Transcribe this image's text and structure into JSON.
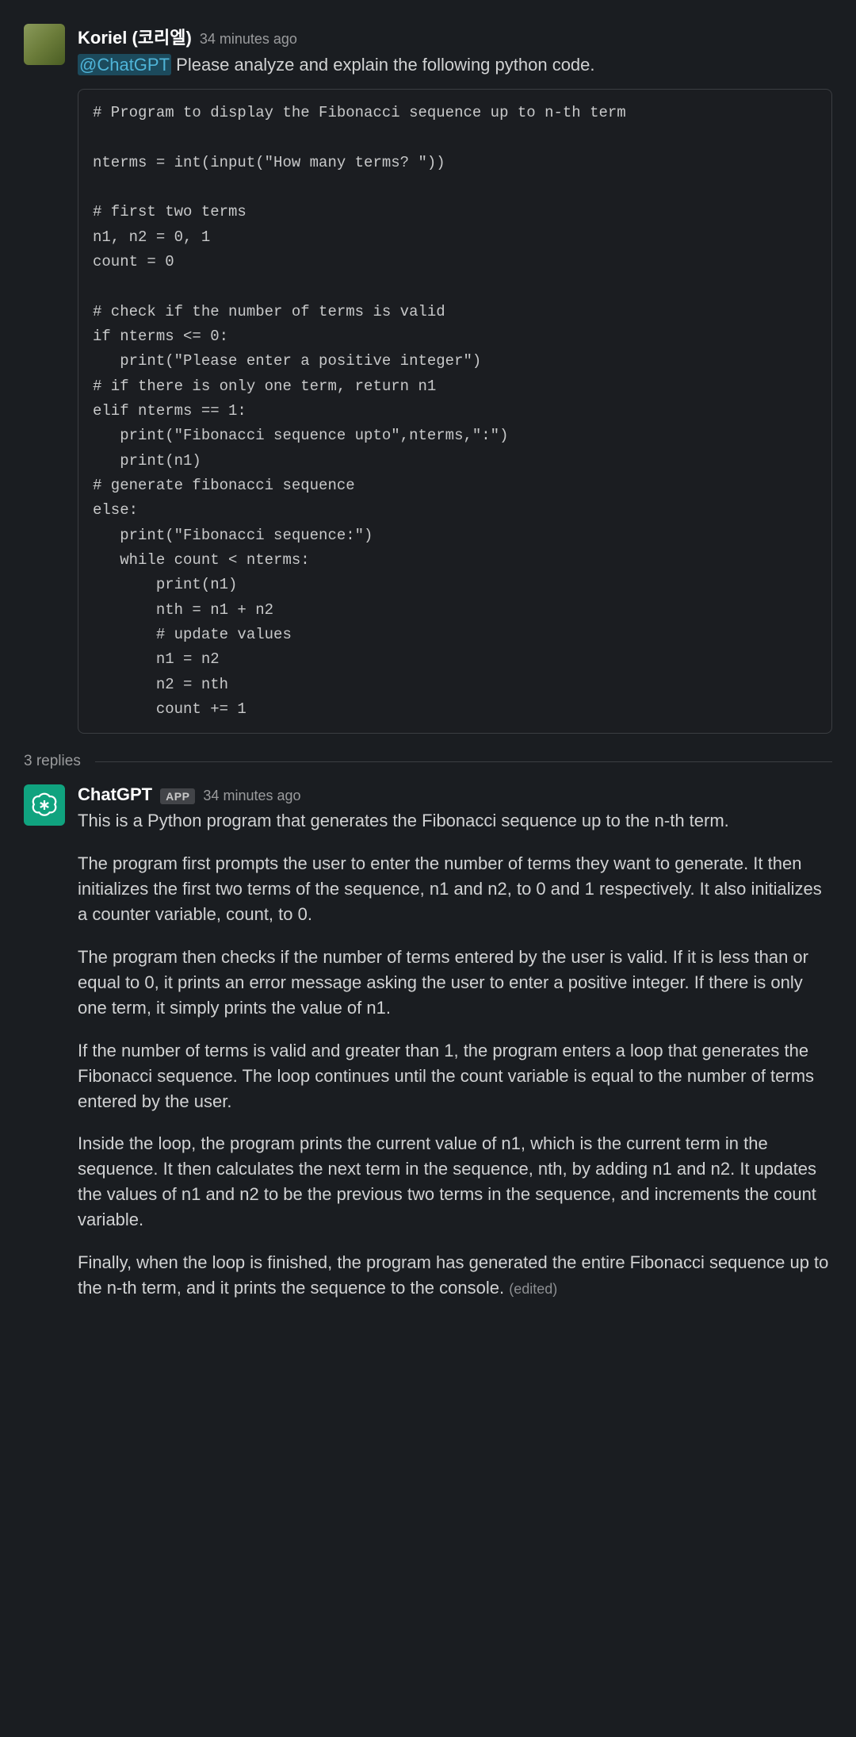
{
  "message1": {
    "username": "Koriel (코리엘)",
    "timestamp": "34 minutes ago",
    "mention": "@ChatGPT",
    "text": " Please analyze and explain the following python code.",
    "code": "# Program to display the Fibonacci sequence up to n-th term\n\nnterms = int(input(\"How many terms? \"))\n\n# first two terms\nn1, n2 = 0, 1\ncount = 0\n\n# check if the number of terms is valid\nif nterms <= 0:\n   print(\"Please enter a positive integer\")\n# if there is only one term, return n1\nelif nterms == 1:\n   print(\"Fibonacci sequence upto\",nterms,\":\")\n   print(n1)\n# generate fibonacci sequence\nelse:\n   print(\"Fibonacci sequence:\")\n   while count < nterms:\n       print(n1)\n       nth = n1 + n2\n       # update values\n       n1 = n2\n       n2 = nth\n       count += 1"
  },
  "replies_label": "3 replies",
  "message2": {
    "username": "ChatGPT",
    "app_badge": "APP",
    "timestamp": "34 minutes ago",
    "paragraphs": [
      "This is a Python program that generates the Fibonacci sequence up to the n-th term.",
      "The program first prompts the user to enter the number of terms they want to generate. It then initializes the first two terms of the sequence, n1 and n2, to 0 and 1 respectively. It also initializes a counter variable, count, to 0.",
      "The program then checks if the number of terms entered by the user is valid. If it is less than or equal to 0, it prints an error message asking the user to enter a positive integer. If there is only one term, it simply prints the value of n1.",
      "If the number of terms is valid and greater than 1, the program enters a loop that generates the Fibonacci sequence. The loop continues until the count variable is equal to the number of terms entered by the user.",
      "Inside the loop, the program prints the current value of n1, which is the current term in the sequence. It then calculates the next term in the sequence, nth, by adding n1 and n2. It updates the values of n1 and n2 to be the previous two terms in the sequence, and increments the count variable.",
      "Finally, when the loop is finished, the program has generated the entire Fibonacci sequence up to the n-th term, and it prints the sequence to the console."
    ],
    "edited": "(edited)"
  }
}
